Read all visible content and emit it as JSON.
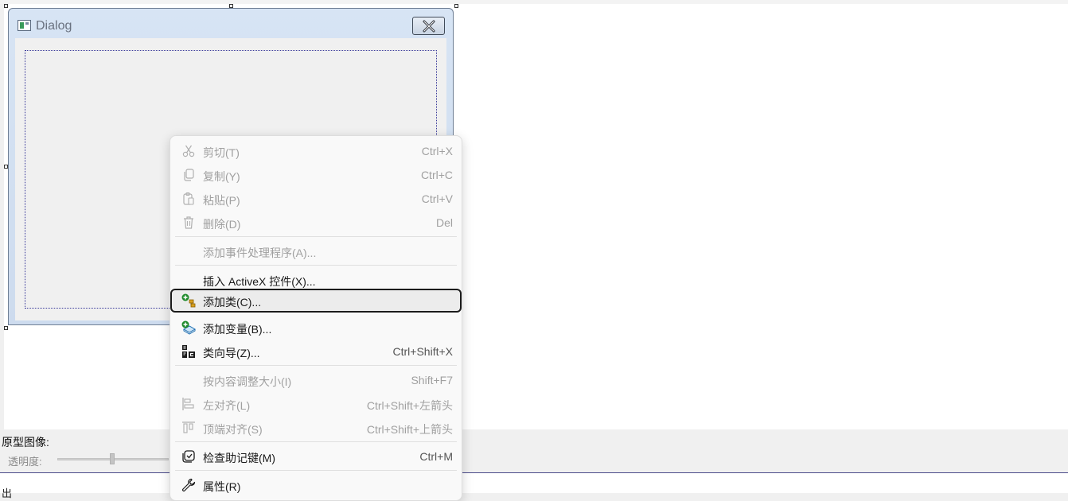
{
  "dialog": {
    "title": "Dialog"
  },
  "bottom_panel": {
    "prototype_image_label": "原型图像:",
    "opacity_label": "透明度:",
    "output_label": "出"
  },
  "context_menu": {
    "items": [
      {
        "label": "剪切(T)",
        "shortcut": "Ctrl+X",
        "icon": "scissors-icon",
        "enabled": false
      },
      {
        "label": "复制(Y)",
        "shortcut": "Ctrl+C",
        "icon": "copy-icon",
        "enabled": false
      },
      {
        "label": "粘贴(P)",
        "shortcut": "Ctrl+V",
        "icon": "paste-icon",
        "enabled": false
      },
      {
        "label": "删除(D)",
        "shortcut": "Del",
        "icon": "trash-icon",
        "enabled": false
      },
      {
        "label": "添加事件处理程序(A)...",
        "shortcut": "",
        "icon": "",
        "enabled": false
      },
      {
        "label": "插入 ActiveX 控件(X)...",
        "shortcut": "",
        "icon": "",
        "enabled": true
      },
      {
        "label": "添加类(C)...",
        "shortcut": "",
        "icon": "add-class-icon",
        "enabled": true,
        "highlighted": true
      },
      {
        "label": "添加变量(B)...",
        "shortcut": "",
        "icon": "add-variable-icon",
        "enabled": true
      },
      {
        "label": "类向导(Z)...",
        "shortcut": "Ctrl+Shift+X",
        "icon": "class-wizard-icon",
        "enabled": true
      },
      {
        "label": "按内容调整大小(I)",
        "shortcut": "Shift+F7",
        "icon": "",
        "enabled": false
      },
      {
        "label": "左对齐(L)",
        "shortcut": "Ctrl+Shift+左箭头",
        "icon": "align-left-icon",
        "enabled": false
      },
      {
        "label": "顶端对齐(S)",
        "shortcut": "Ctrl+Shift+上箭头",
        "icon": "align-top-icon",
        "enabled": false
      },
      {
        "label": "检查助记键(M)",
        "shortcut": "Ctrl+M",
        "icon": "check-mnemonics-icon",
        "enabled": true
      },
      {
        "label": "属性(R)",
        "shortcut": "",
        "icon": "wrench-icon",
        "enabled": true
      }
    ]
  },
  "colors": {
    "menu_background": "#f9f9f9",
    "highlight_border": "#1c1c1c",
    "disabled_text": "#a0a0a0",
    "dialog_frame": "#d7e4f4"
  },
  "opacity_slider": {
    "value": 0.5
  }
}
